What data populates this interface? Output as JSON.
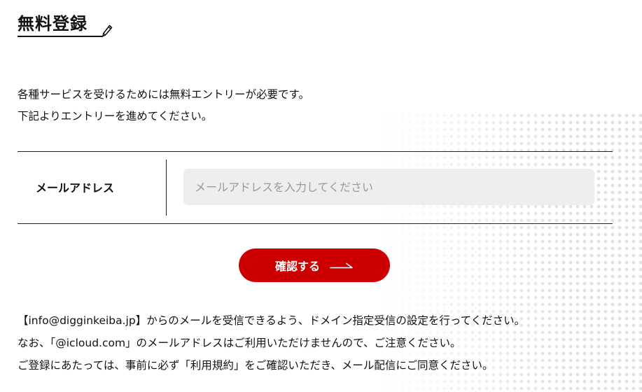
{
  "header": {
    "title": "無料登録",
    "title_icon": "pencil-icon"
  },
  "intro": {
    "line1": "各種サービスを受けるためには無料エントリーが必要です。",
    "line2": "下記よりエントリーを進めてください。"
  },
  "form": {
    "email_label": "メールアドレス",
    "email_value": "",
    "email_placeholder": "メールアドレスを入力してください",
    "submit_label": "確認する",
    "submit_icon": "arrow-right-icon"
  },
  "notes": {
    "line1": "【info@digginkeiba.jp】からのメールを受信できるよう、ドメイン指定受信の設定を行ってください。",
    "line2": "なお、「@icloud.com」のメールアドレスはご利用いただけませんので、ご注意ください。",
    "line3": "ご登録にあたっては、事前に必ず「利用規約」をご確認いただき、メール配信にご同意ください。"
  },
  "colors": {
    "accent": "#cc0000",
    "input_background": "#eeeeee",
    "text": "#111111"
  }
}
